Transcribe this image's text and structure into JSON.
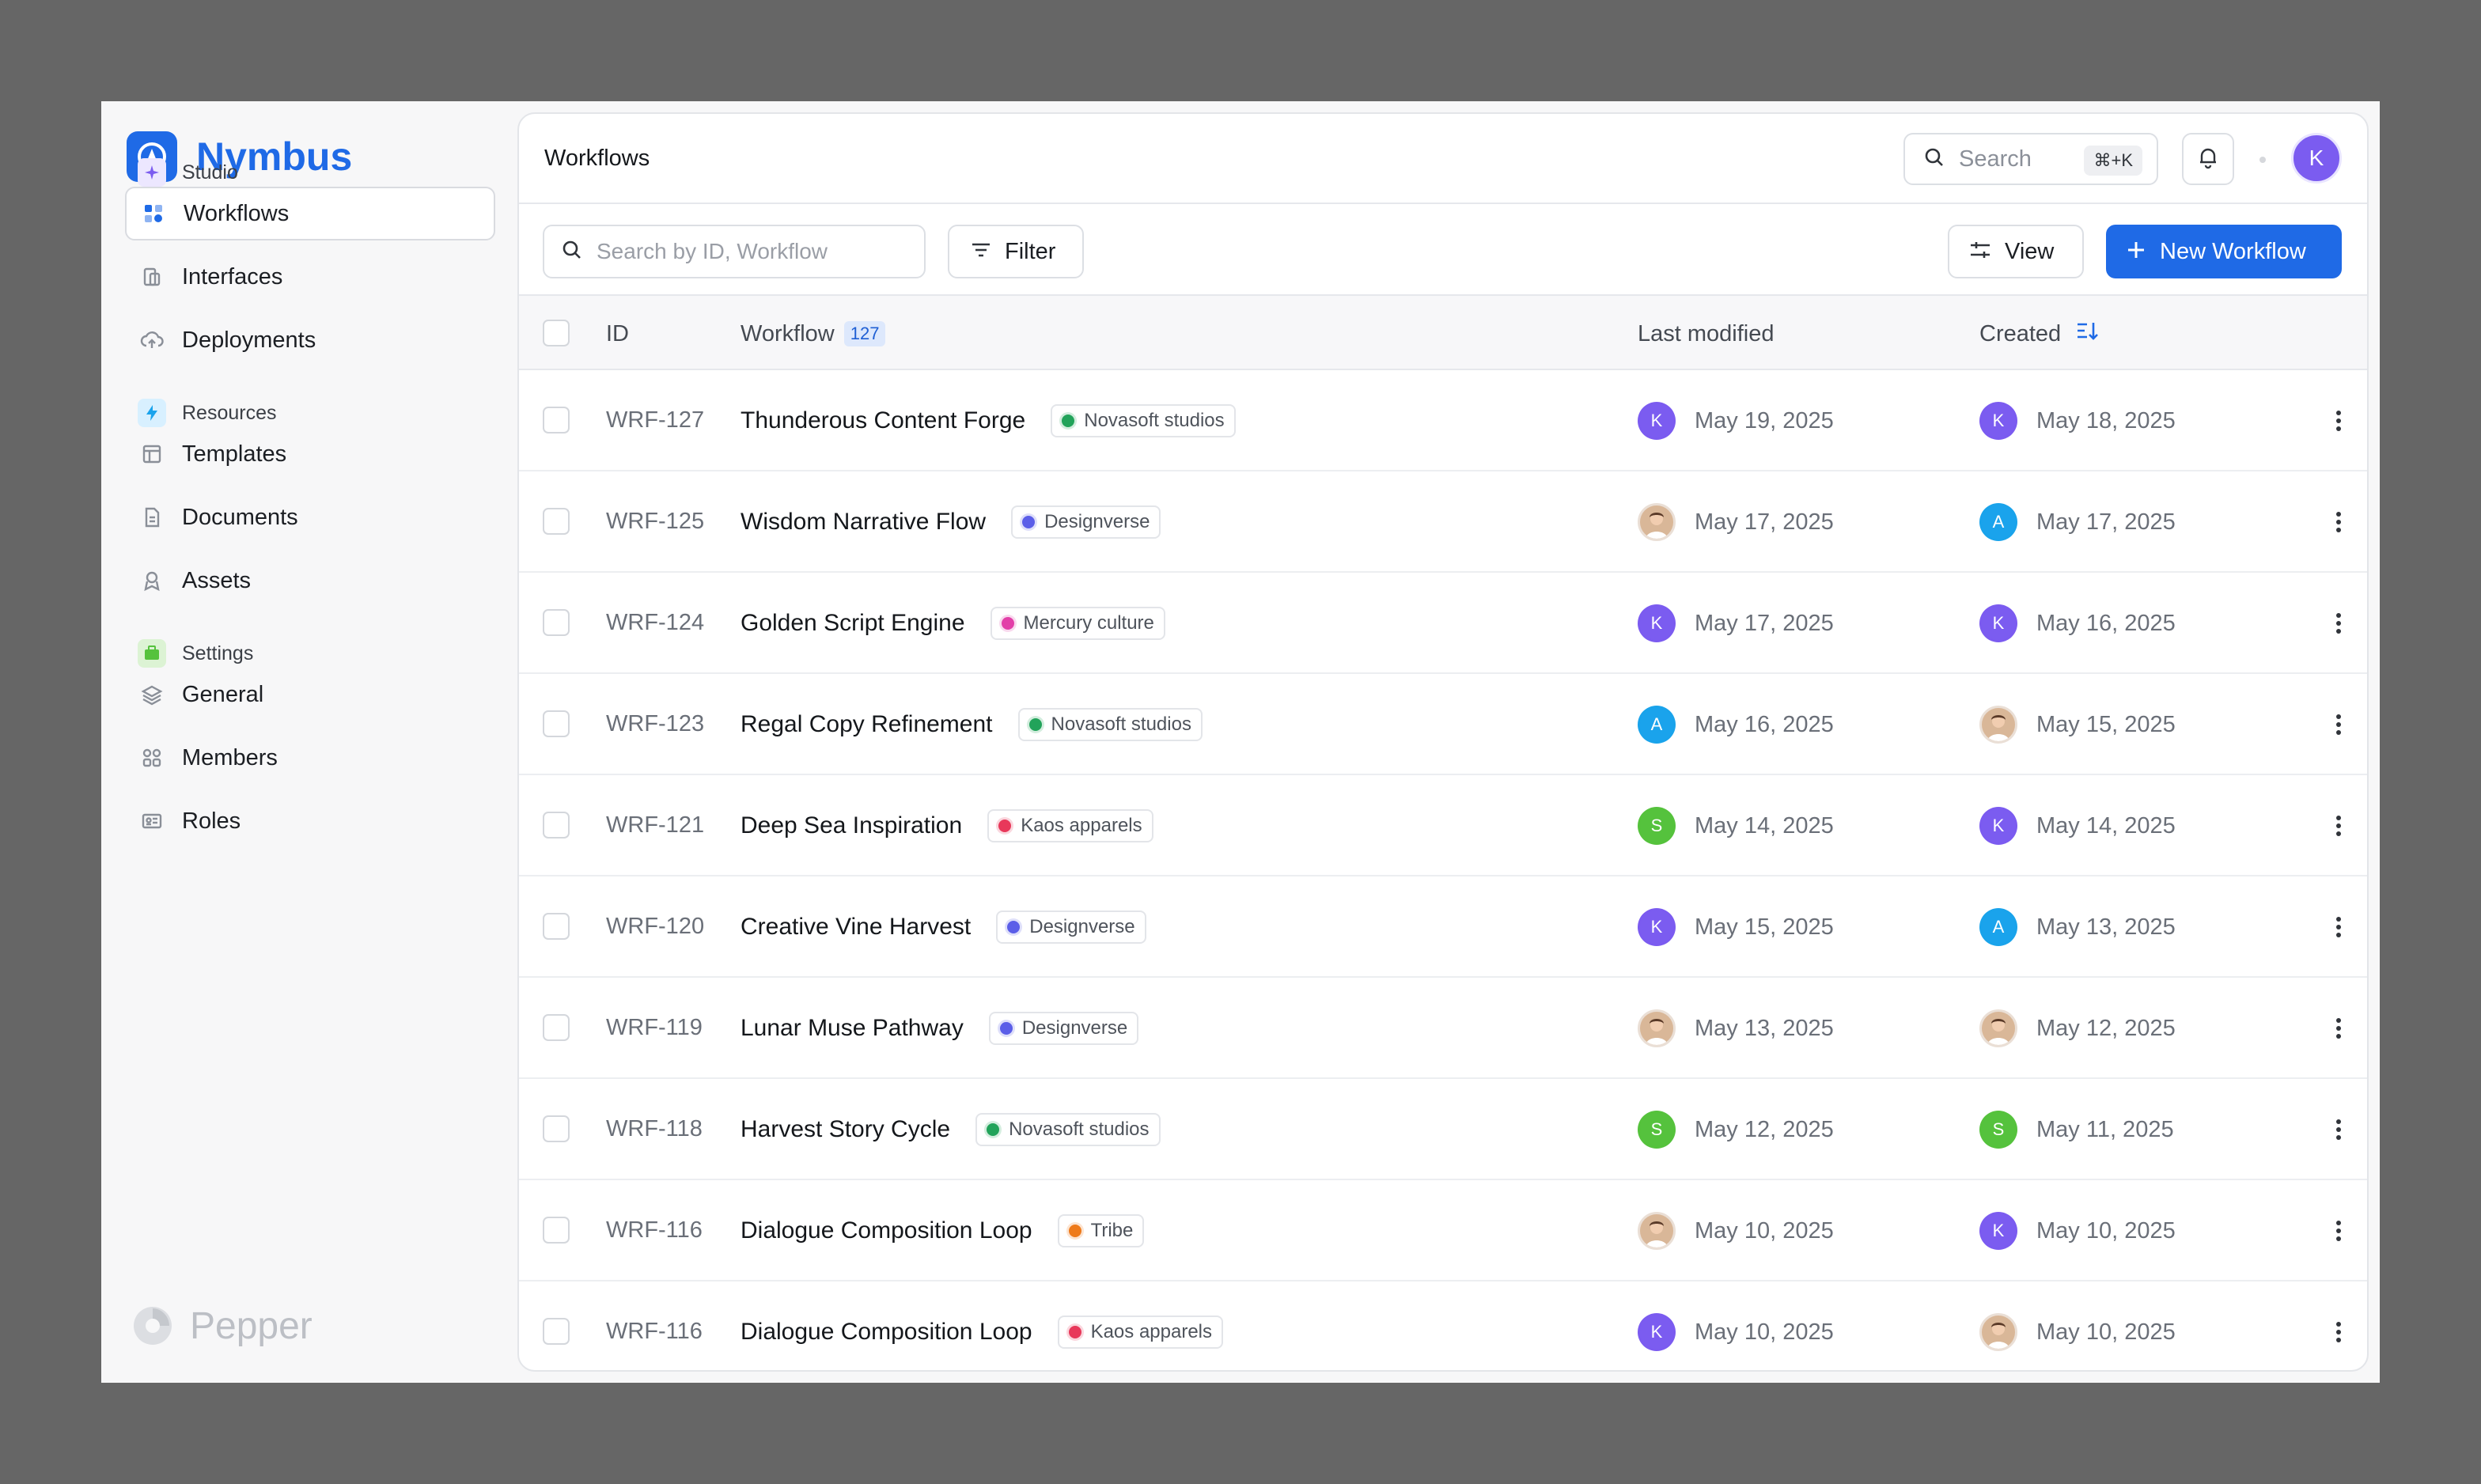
{
  "brand": {
    "name": "Nymbus"
  },
  "footer": {
    "name": "Pepper"
  },
  "sidebar": {
    "sections": [
      {
        "label": "Studio",
        "icon": "sparkle-icon",
        "color": "#7b5cf0"
      },
      {
        "label": "Resources",
        "icon": "bolt-icon",
        "color": "#1aa3ec"
      },
      {
        "label": "Settings",
        "icon": "briefcase-icon",
        "color": "#55c23d"
      }
    ],
    "items": [
      {
        "label": "Workflows",
        "icon": "workflow-icon",
        "active": true
      },
      {
        "label": "Interfaces",
        "icon": "interfaces-icon"
      },
      {
        "label": "Deployments",
        "icon": "cloud-upload-icon"
      },
      {
        "label": "Templates",
        "icon": "template-icon"
      },
      {
        "label": "Documents",
        "icon": "document-icon"
      },
      {
        "label": "Assets",
        "icon": "assets-icon"
      },
      {
        "label": "General",
        "icon": "layers-icon"
      },
      {
        "label": "Members",
        "icon": "members-icon"
      },
      {
        "label": "Roles",
        "icon": "roles-icon"
      }
    ]
  },
  "header": {
    "title": "Workflows",
    "search_label": "Search",
    "shortcut": "⌘+K",
    "user_initial": "K"
  },
  "toolbar": {
    "search_placeholder": "Search by ID, Workflow",
    "filter_label": "Filter",
    "view_label": "View",
    "new_label": "New Workflow"
  },
  "table": {
    "columns": {
      "id": "ID",
      "workflow": "Workflow",
      "workflow_count": "127",
      "last_modified": "Last modified",
      "created": "Created"
    },
    "user_colors": {
      "K": "#7b5cf0",
      "A": "#1aa3ec",
      "S": "#55c23d",
      "photo": "#c98a5e"
    },
    "rows": [
      {
        "id": "WRF-127",
        "name": "Thunderous Content Forge",
        "tag": "Novasoft studios",
        "tag_color": "#22a35a",
        "mod_user": "K",
        "mod_date": "May 19, 2025",
        "created_user": "K",
        "created_date": "May 18, 2025"
      },
      {
        "id": "WRF-125",
        "name": "Wisdom Narrative Flow",
        "tag": "Designverse",
        "tag_color": "#5b5ee8",
        "mod_user": "photo",
        "mod_date": "May 17, 2025",
        "created_user": "A",
        "created_date": "May 17, 2025"
      },
      {
        "id": "WRF-124",
        "name": "Golden Script Engine",
        "tag": "Mercury culture",
        "tag_color": "#e23fa8",
        "mod_user": "K",
        "mod_date": "May 17, 2025",
        "created_user": "K",
        "created_date": "May 16, 2025"
      },
      {
        "id": "WRF-123",
        "name": "Regal Copy Refinement",
        "tag": "Novasoft studios",
        "tag_color": "#22a35a",
        "mod_user": "A",
        "mod_date": "May 16, 2025",
        "created_user": "photo",
        "created_date": "May 15, 2025"
      },
      {
        "id": "WRF-121",
        "name": "Deep Sea Inspiration",
        "tag": "Kaos apparels",
        "tag_color": "#e8385a",
        "mod_user": "S",
        "mod_date": "May 14, 2025",
        "created_user": "K",
        "created_date": "May 14, 2025"
      },
      {
        "id": "WRF-120",
        "name": "Creative Vine Harvest",
        "tag": "Designverse",
        "tag_color": "#5b5ee8",
        "mod_user": "K",
        "mod_date": "May 15, 2025",
        "created_user": "A",
        "created_date": "May 13, 2025"
      },
      {
        "id": "WRF-119",
        "name": "Lunar Muse Pathway",
        "tag": "Designverse",
        "tag_color": "#5b5ee8",
        "mod_user": "photo",
        "mod_date": "May 13, 2025",
        "created_user": "photo",
        "created_date": "May 12, 2025"
      },
      {
        "id": "WRF-118",
        "name": "Harvest Story Cycle",
        "tag": "Novasoft studios",
        "tag_color": "#22a35a",
        "mod_user": "S",
        "mod_date": "May 12, 2025",
        "created_user": "S",
        "created_date": "May 11, 2025"
      },
      {
        "id": "WRF-116",
        "name": "Dialogue Composition Loop",
        "tag": "Tribe",
        "tag_color": "#ee7a1a",
        "mod_user": "photo",
        "mod_date": "May 10, 2025",
        "created_user": "K",
        "created_date": "May 10, 2025"
      },
      {
        "id": "WRF-116",
        "name": "Dialogue Composition Loop",
        "tag": "Kaos apparels",
        "tag_color": "#e8385a",
        "mod_user": "K",
        "mod_date": "May 10, 2025",
        "created_user": "photo",
        "created_date": "May 10, 2025"
      }
    ]
  }
}
